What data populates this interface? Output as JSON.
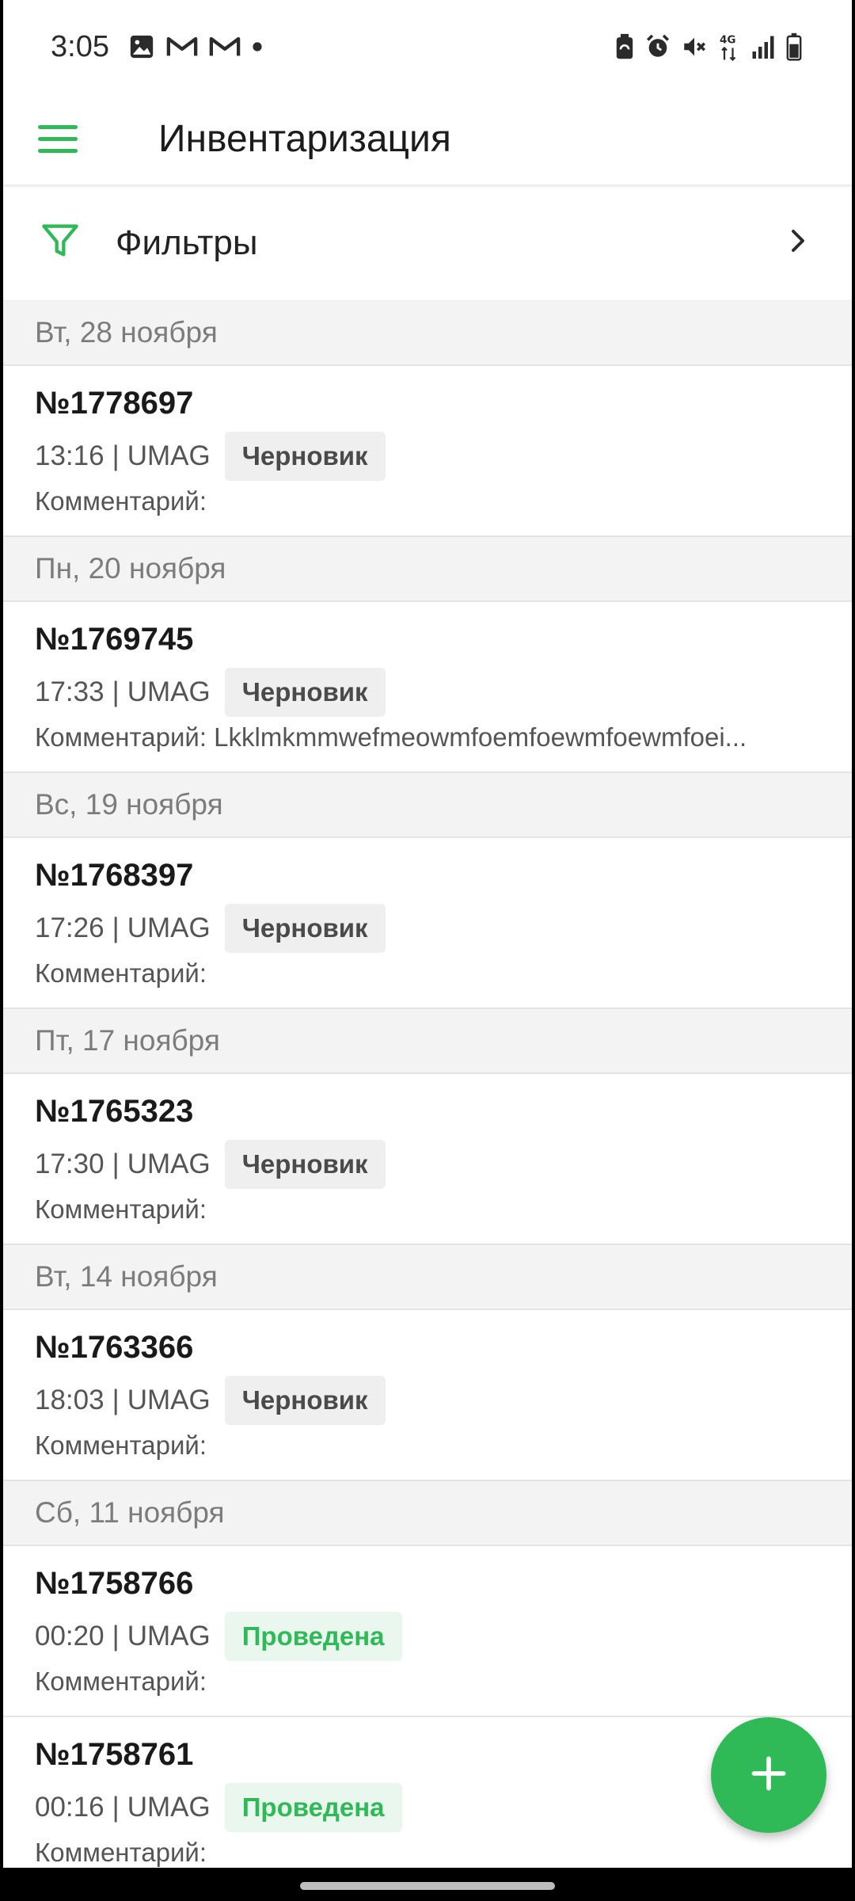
{
  "status_bar": {
    "time": "3:05",
    "icons_left": [
      "image-icon",
      "gmail-icon",
      "gmail-icon",
      "notification-dot-icon"
    ],
    "icons_right": [
      "battery-saver-icon",
      "alarm-icon",
      "mute-icon",
      "network-4g-icon",
      "signal-icon",
      "battery-icon"
    ],
    "network_label": "4G"
  },
  "app_bar": {
    "title": "Инвентаризация",
    "menu_icon": "hamburger-menu-icon"
  },
  "filters": {
    "label": "Фильтры",
    "icon": "filter-icon",
    "chevron_icon": "chevron-right-icon"
  },
  "groups": [
    {
      "date": "Вт, 28 ноября",
      "items": [
        {
          "number": "№1778697",
          "time": "13:16",
          "store": "UMAG",
          "status": "Черновик",
          "status_type": "draft",
          "comment": "Комментарий:"
        }
      ]
    },
    {
      "date": "Пн, 20 ноября",
      "items": [
        {
          "number": "№1769745",
          "time": "17:33",
          "store": "UMAG",
          "status": "Черновик",
          "status_type": "draft",
          "comment": "Комментарий: Lkklmkmmwefmeowmfoemfoewmfoewmfoei..."
        }
      ]
    },
    {
      "date": "Вс, 19 ноября",
      "items": [
        {
          "number": "№1768397",
          "time": "17:26",
          "store": "UMAG",
          "status": "Черновик",
          "status_type": "draft",
          "comment": "Комментарий:"
        }
      ]
    },
    {
      "date": "Пт, 17 ноября",
      "items": [
        {
          "number": "№1765323",
          "time": "17:30",
          "store": "UMAG",
          "status": "Черновик",
          "status_type": "draft",
          "comment": "Комментарий:"
        }
      ]
    },
    {
      "date": "Вт, 14 ноября",
      "items": [
        {
          "number": "№1763366",
          "time": "18:03",
          "store": "UMAG",
          "status": "Черновик",
          "status_type": "draft",
          "comment": "Комментарий:"
        }
      ]
    },
    {
      "date": "Сб, 11 ноября",
      "items": [
        {
          "number": "№1758766",
          "time": "00:20",
          "store": "UMAG",
          "status": "Проведена",
          "status_type": "done",
          "comment": "Комментарий:"
        },
        {
          "number": "№1758761",
          "time": "00:16",
          "store": "UMAG",
          "status": "Проведена",
          "status_type": "done",
          "comment": "Комментарий:"
        }
      ]
    }
  ],
  "fab": {
    "icon": "plus-icon"
  },
  "colors": {
    "accent": "#2fba57",
    "draft_badge_bg": "#efefef",
    "done_badge_bg": "#eaf7ef",
    "date_header_bg": "#f3f3f3"
  }
}
